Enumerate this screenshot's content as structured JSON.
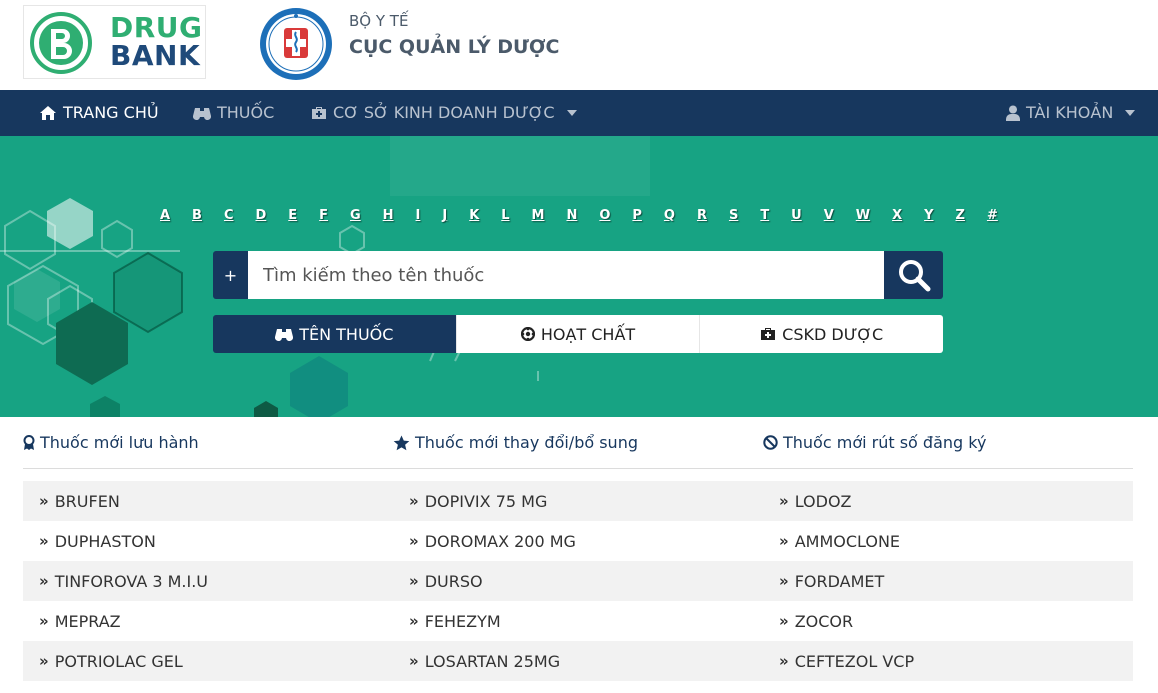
{
  "brand": {
    "logo_line1": "DRUG",
    "logo_line2": "BANK",
    "ministry_line1": "BỘ Y TẾ",
    "ministry_line2": "CỤC QUẢN LÝ DƯỢC"
  },
  "nav": {
    "home": "TRANG CHỦ",
    "drugs": "THUỐC",
    "pharma_business": "CƠ SỞ KINH DOANH DƯỢC",
    "account": "TÀI KHOẢN"
  },
  "alphabet": [
    "A",
    "B",
    "C",
    "D",
    "E",
    "F",
    "G",
    "H",
    "I",
    "J",
    "K",
    "L",
    "M",
    "N",
    "O",
    "P",
    "Q",
    "R",
    "S",
    "T",
    "U",
    "V",
    "W",
    "X",
    "Y",
    "Z",
    "#"
  ],
  "search": {
    "plus_label": "+",
    "placeholder": "Tìm kiếm theo tên thuốc"
  },
  "search_modes": {
    "drug_name": "TÊN THUỐC",
    "active_ingredient": "HOẠT CHẤT",
    "pharma_facility": "CSKD DƯỢC"
  },
  "lists": {
    "headers": {
      "new_circulated": "Thuốc mới lưu hành",
      "changed": "Thuốc mới thay đổi/bổ sung",
      "withdrawn": "Thuốc mới rút số đăng ký"
    },
    "rows": [
      [
        "BRUFEN",
        "DOPIVIX 75 MG",
        "LODOZ"
      ],
      [
        "DUPHASTON",
        "DOROMAX 200 MG",
        "AMMOCLONE"
      ],
      [
        "TINFOROVA 3 M.I.U",
        "DURSO",
        "FORDAMET"
      ],
      [
        "MEPRAZ",
        "FEHEZYM",
        "ZOCOR"
      ],
      [
        "POTRIOLAC GEL",
        "LOSARTAN 25MG",
        "CEFTEZOL VCP"
      ]
    ]
  },
  "colors": {
    "navy": "#17375e",
    "green": "#17a383",
    "logo_green": "#2fae72"
  }
}
